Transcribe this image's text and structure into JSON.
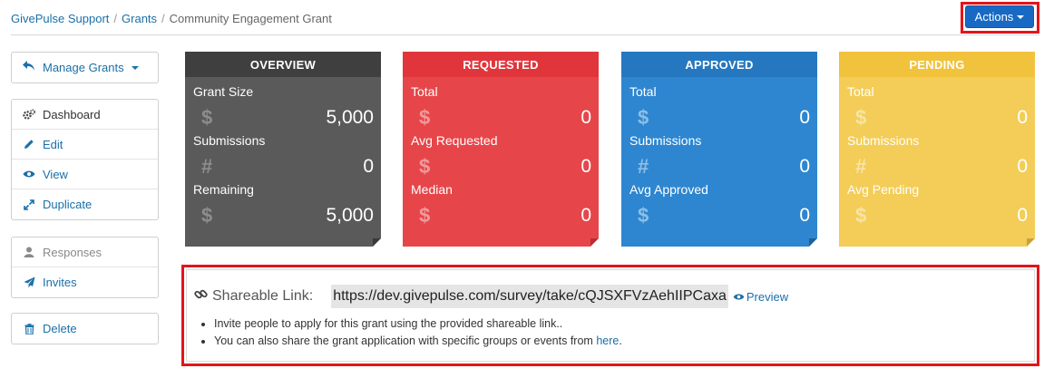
{
  "breadcrumb": {
    "items": [
      "GivePulse Support",
      "Grants"
    ],
    "separator": "/",
    "current": "Community Engagement Grant"
  },
  "actions": {
    "label": "Actions"
  },
  "sidebar": {
    "manage": "Manage Grants",
    "group1": [
      "Dashboard",
      "Edit",
      "View",
      "Duplicate"
    ],
    "group2": [
      "Responses",
      "Invites"
    ],
    "group3": [
      "Delete"
    ]
  },
  "cards": [
    {
      "title": "OVERVIEW",
      "color": "#5a5a5a",
      "stats": [
        {
          "label": "Grant Size",
          "glyph": "$",
          "value": "5,000"
        },
        {
          "label": "Submissions",
          "glyph": "#",
          "value": "0"
        },
        {
          "label": "Remaining",
          "glyph": "$",
          "value": "5,000"
        }
      ]
    },
    {
      "title": "REQUESTED",
      "color": "#e6464a",
      "stats": [
        {
          "label": "Total",
          "glyph": "$",
          "value": "0"
        },
        {
          "label": "Avg Requested",
          "glyph": "$",
          "value": "0"
        },
        {
          "label": "Median",
          "glyph": "$",
          "value": "0"
        }
      ]
    },
    {
      "title": "APPROVED",
      "color": "#2e86d0",
      "stats": [
        {
          "label": "Total",
          "glyph": "$",
          "value": "0"
        },
        {
          "label": "Submissions",
          "glyph": "#",
          "value": "0"
        },
        {
          "label": "Avg Approved",
          "glyph": "$",
          "value": "0"
        }
      ]
    },
    {
      "title": "PENDING",
      "color": "#f3cd57",
      "stats": [
        {
          "label": "Total",
          "glyph": "$",
          "value": "0"
        },
        {
          "label": "Submissions",
          "glyph": "#",
          "value": "0"
        },
        {
          "label": "Avg Pending",
          "glyph": "$",
          "value": "0"
        }
      ]
    }
  ],
  "share": {
    "label": "Shareable Link:",
    "url": "https://dev.givepulse.com/survey/take/cQJSXFVzAehIIPCaxa",
    "preview": "Preview",
    "bullet1": "Invite people to apply for this grant using the provided shareable link..",
    "bullet2_text": "You can also share the grant application with specific groups or events from",
    "bullet2_link": "here",
    "bullet2_end": "."
  },
  "highlight_color": "#e4141b"
}
